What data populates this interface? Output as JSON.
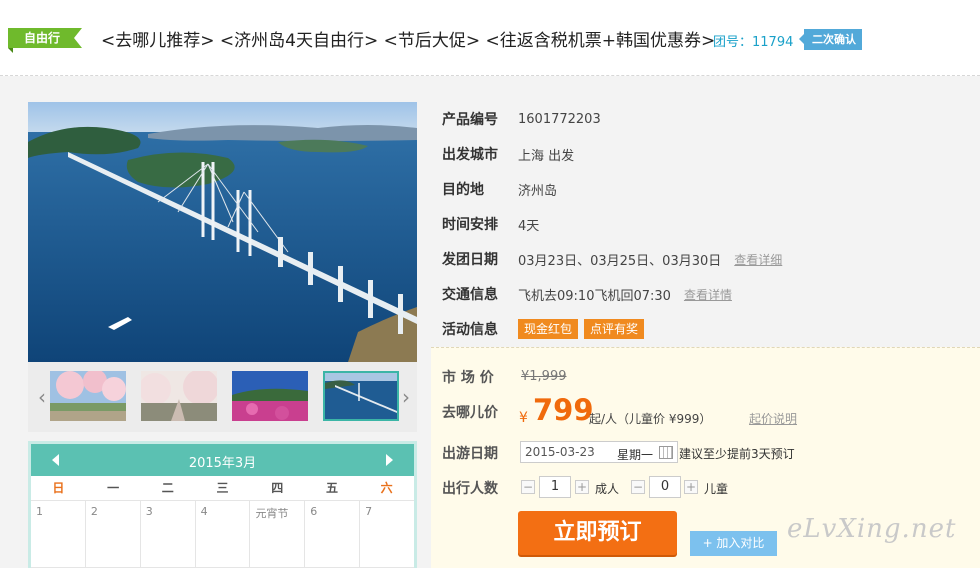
{
  "header": {
    "tag": "自由行",
    "title": "<去哪儿推荐> <济州岛4天自由行> <节后大促> <往返含税机票+韩国优惠券>",
    "group_no_label": "团号：11794",
    "confirm_badge": "二次确认"
  },
  "gallery": {
    "prev_icon": "chevron-left-icon",
    "next_icon": "chevron-right-icon",
    "thumbnails": 4,
    "active_thumbnail_index": 4
  },
  "calendar": {
    "title": "2015年3月",
    "weekdays": [
      "日",
      "一",
      "二",
      "三",
      "四",
      "五",
      "六"
    ],
    "first_row": [
      "1",
      "2",
      "3",
      "4",
      "元宵节",
      "6",
      "7"
    ]
  },
  "product": {
    "rows": [
      {
        "label": "产品编号",
        "value": "1601772203"
      },
      {
        "label": "出发城市",
        "value": "上海 出发"
      },
      {
        "label": "目的地",
        "value": "济州岛"
      },
      {
        "label": "时间安排",
        "value": "4天"
      },
      {
        "label": "发团日期",
        "value": "03月23日、03月25日、03月30日",
        "link": "查看详细"
      },
      {
        "label": "交通信息",
        "value": "飞机去09:10飞机回07:30",
        "link": "查看详情"
      },
      {
        "label": "活动信息",
        "promos": [
          "现金红包",
          "点评有奖"
        ]
      }
    ]
  },
  "price": {
    "market_label": "市 场 价",
    "market_price": "¥1,999",
    "qunar_label": "去哪儿价",
    "currency": "¥",
    "price": "799",
    "suffix": "起/人（儿童价 ¥999）",
    "explain_link": "起价说明",
    "date_label": "出游日期",
    "date_value": "2015-03-23",
    "weekday": "星期一",
    "advance_note": "建议至少提前3天预订",
    "travelers_label": "出行人数",
    "adult_qty": "1",
    "adult_label": "成人",
    "child_qty": "0",
    "child_label": "儿童",
    "minus": "−",
    "plus": "+",
    "book_button": "立即预订",
    "compare_button": "+ 加入对比",
    "watermark": "eLvXing.net",
    "accent_color": "#f36f13"
  }
}
